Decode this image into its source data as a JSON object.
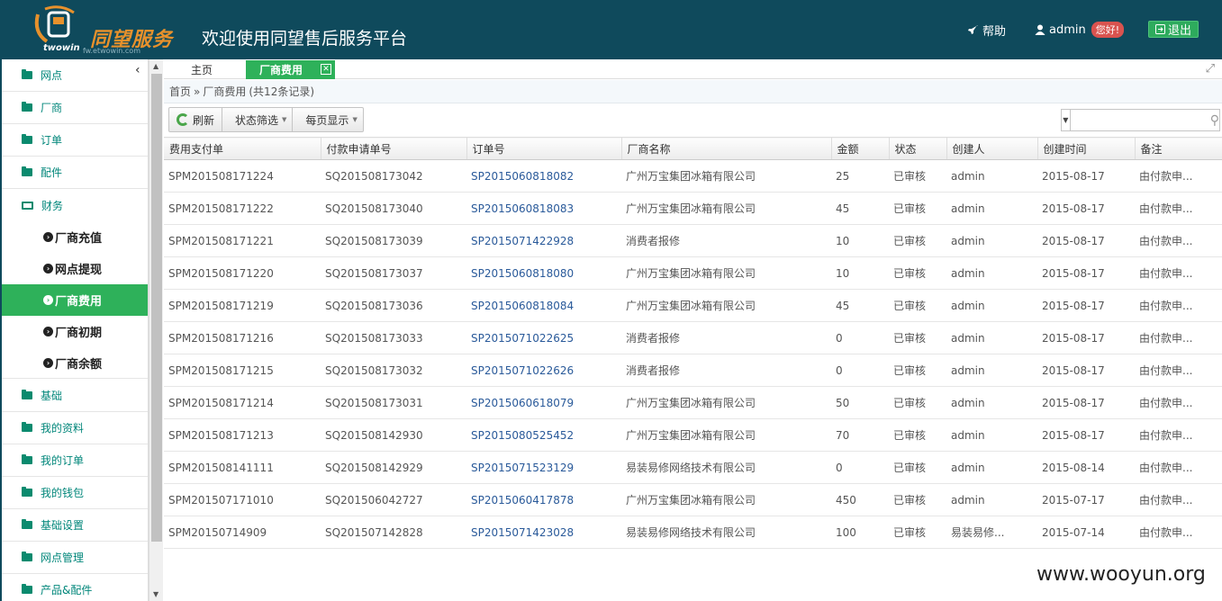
{
  "header": {
    "logo_text": "同望服务",
    "logo_sub": "twowin",
    "logo_url": "fw.etwowin.com",
    "title": "欢迎使用同望售后服务平台",
    "help_label": "帮助",
    "user_label": "admin",
    "hello_badge": "您好!",
    "logout_label": "退出"
  },
  "sidebar": {
    "items": [
      {
        "label": "网点"
      },
      {
        "label": "厂商"
      },
      {
        "label": "订单"
      },
      {
        "label": "配件"
      },
      {
        "label": "财务"
      },
      {
        "label": "基础"
      },
      {
        "label": "我的资料"
      },
      {
        "label": "我的订单"
      },
      {
        "label": "我的钱包"
      },
      {
        "label": "基础设置"
      },
      {
        "label": "网点管理"
      },
      {
        "label": "产品&配件"
      }
    ],
    "sub_items": [
      {
        "label": "厂商充值"
      },
      {
        "label": "网点提现"
      },
      {
        "label": "厂商费用"
      },
      {
        "label": "厂商初期"
      },
      {
        "label": "厂商余额"
      }
    ]
  },
  "tabs": {
    "home": "主页",
    "active": "厂商费用"
  },
  "breadcrumb": {
    "home": "首页",
    "separator": "»",
    "current": "厂商费用",
    "count": "(共12条记录)"
  },
  "toolbar": {
    "refresh": "刷新",
    "status_filter": "状态筛选",
    "page_size": "每页显示"
  },
  "search": {
    "placeholder": ""
  },
  "table": {
    "columns": [
      "费用支付单",
      "付款申请单号",
      "订单号",
      "厂商名称",
      "金额",
      "状态",
      "创建人",
      "创建时间",
      "备注"
    ],
    "rows": [
      [
        "SPM201508171224",
        "SQ201508173042",
        "SP2015060818082",
        "广州万宝集团冰箱有限公司",
        "25",
        "已审核",
        "admin",
        "2015-08-17",
        "由付款申..."
      ],
      [
        "SPM201508171222",
        "SQ201508173040",
        "SP2015060818083",
        "广州万宝集团冰箱有限公司",
        "45",
        "已审核",
        "admin",
        "2015-08-17",
        "由付款申..."
      ],
      [
        "SPM201508171221",
        "SQ201508173039",
        "SP2015071422928",
        "消费者报修",
        "10",
        "已审核",
        "admin",
        "2015-08-17",
        "由付款申..."
      ],
      [
        "SPM201508171220",
        "SQ201508173037",
        "SP2015060818080",
        "广州万宝集团冰箱有限公司",
        "10",
        "已审核",
        "admin",
        "2015-08-17",
        "由付款申..."
      ],
      [
        "SPM201508171219",
        "SQ201508173036",
        "SP2015060818084",
        "广州万宝集团冰箱有限公司",
        "45",
        "已审核",
        "admin",
        "2015-08-17",
        "由付款申..."
      ],
      [
        "SPM201508171216",
        "SQ201508173033",
        "SP2015071022625",
        "消费者报修",
        "0",
        "已审核",
        "admin",
        "2015-08-17",
        "由付款申..."
      ],
      [
        "SPM201508171215",
        "SQ201508173032",
        "SP2015071022626",
        "消费者报修",
        "0",
        "已审核",
        "admin",
        "2015-08-17",
        "由付款申..."
      ],
      [
        "SPM201508171214",
        "SQ201508173031",
        "SP2015060618079",
        "广州万宝集团冰箱有限公司",
        "50",
        "已审核",
        "admin",
        "2015-08-17",
        "由付款申..."
      ],
      [
        "SPM201508171213",
        "SQ201508142930",
        "SP2015080525452",
        "广州万宝集团冰箱有限公司",
        "70",
        "已审核",
        "admin",
        "2015-08-17",
        "由付款申..."
      ],
      [
        "SPM201508141111",
        "SQ201508142929",
        "SP2015071523129",
        "易装易修网络技术有限公司",
        "0",
        "已审核",
        "admin",
        "2015-08-14",
        "由付款申..."
      ],
      [
        "SPM201507171010",
        "SQ201506042727",
        "SP2015060417878",
        "广州万宝集团冰箱有限公司",
        "450",
        "已审核",
        "admin",
        "2015-07-17",
        "由付款申..."
      ],
      [
        "SPM20150714909",
        "SQ201507142828",
        "SP2015071423028",
        "易装易修网络技术有限公司",
        "100",
        "已审核",
        "易装易修...",
        "2015-07-14",
        "由付款申..."
      ]
    ]
  },
  "watermark": "www.wooyun.org",
  "colors": {
    "header_bg": "#0f4a5c",
    "accent_green": "#2eb15a",
    "menu_text": "#00867a",
    "link_blue": "#2a5a9a"
  }
}
